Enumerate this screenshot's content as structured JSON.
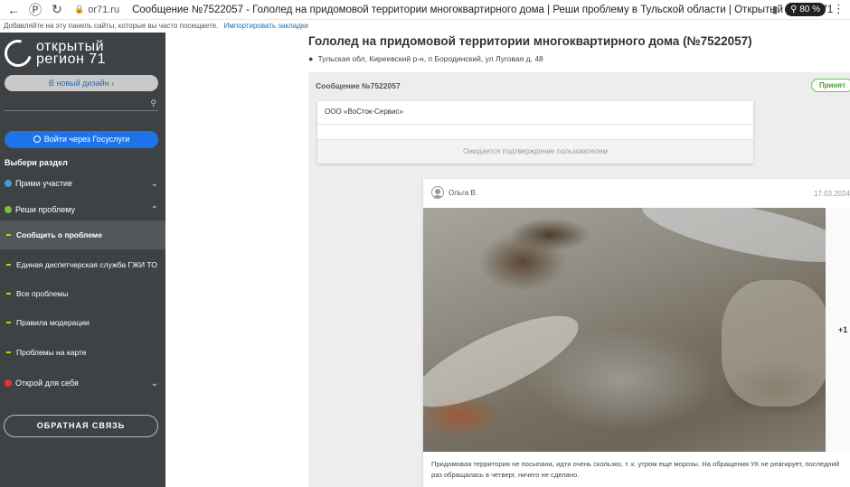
{
  "browser": {
    "url": "or71.ru",
    "tab_title": "Сообщение №7522057 - Гололед на придомовой территории многоквартирного дома | Реши проблему в Тульской области | Открытый регион 71",
    "zoom": "80 %",
    "bookmarks_hint": "Добавляйте на эту панель сайты, которые вы часто посещаете.",
    "bookmarks_import": "Импортировать закладки"
  },
  "sidebar": {
    "logo_line1": "открытый",
    "logo_line2": "регион  71",
    "new_design": "В новый дизайн ›",
    "gosuslugi": "Войти через Госуслуги",
    "section_title": "Выбери раздел",
    "items": [
      {
        "label": "Прими участие",
        "color": "#3aa0d8"
      },
      {
        "label": "Реши проблему",
        "color": "#7cbf3a"
      },
      {
        "label": "Открой для себя",
        "color": "#e0342c"
      }
    ],
    "subitems": [
      {
        "label": "Сообщить о проблеме"
      },
      {
        "label": "Единая диспетчерская служба ГЖИ ТО"
      },
      {
        "label": "Все проблемы"
      },
      {
        "label": "Правила модерации"
      },
      {
        "label": "Проблемы на карте"
      }
    ],
    "feedback": "ОБРАТНАЯ СВЯЗЬ"
  },
  "main": {
    "title": "Гололед на придомовой территории многоквартирного дома (№7522057)",
    "address": "Тульская обл, Киреевский р-н, п Бородинский, ул Луговая д. 48",
    "message_label": "Сообщение №7522057",
    "status": "Принят",
    "org_name": "ООО «ВоСток-Сервис»",
    "org_footer": "Ожидается подтверждение пользователем",
    "post": {
      "author": "Ольга В.",
      "date": "17.03.2024",
      "more_photos": "+1",
      "description": "Придомовая территория не посыпана, идти очень скользко, т. к. утром еще морозы. На обращения УК не реагирует, последний раз обращалась в четверг, ничего не сделано."
    }
  }
}
